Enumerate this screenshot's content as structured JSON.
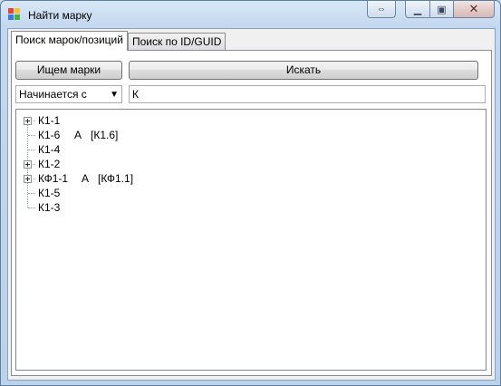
{
  "window": {
    "title": "Найти марку"
  },
  "tabs": [
    {
      "label": "Поиск марок/позиций",
      "active": true
    },
    {
      "label": "Поиск по ID/GUID",
      "active": false
    }
  ],
  "toolbar": {
    "find_marks_label": "Ищем марки",
    "search_label": "Искать"
  },
  "filter": {
    "mode": "Начинается с",
    "query": "К"
  },
  "tree": {
    "items": [
      {
        "label": "К1-1",
        "expandable": true,
        "extra": ""
      },
      {
        "label": "К1-6",
        "expandable": false,
        "extra": "А   [К1.6]"
      },
      {
        "label": "К1-4",
        "expandable": false,
        "extra": ""
      },
      {
        "label": "К1-2",
        "expandable": true,
        "extra": ""
      },
      {
        "label": "КФ1-1",
        "expandable": true,
        "extra": "А   [КФ1.1]"
      },
      {
        "label": "К1-5",
        "expandable": false,
        "extra": ""
      },
      {
        "label": "К1-3",
        "expandable": false,
        "extra": ""
      }
    ]
  }
}
